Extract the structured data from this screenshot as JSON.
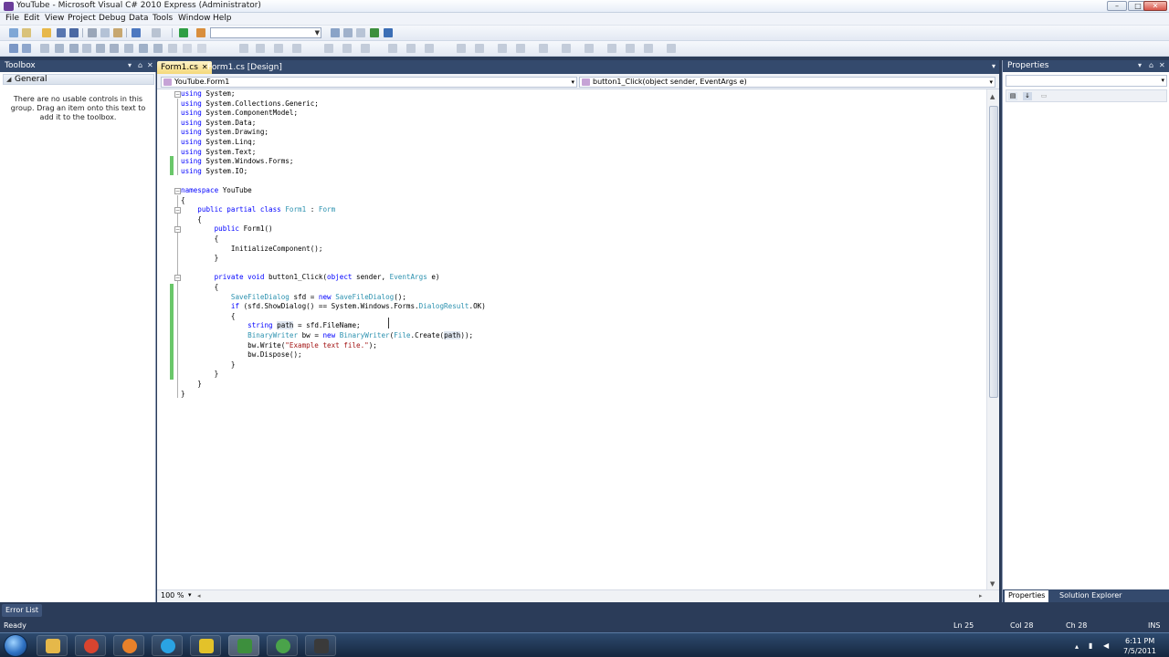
{
  "window": {
    "title": "YouTube - Microsoft Visual C# 2010 Express (Administrator)",
    "min_glyph": "–",
    "max_glyph": "□",
    "close_glyph": "✕"
  },
  "menu": [
    {
      "label": "File"
    },
    {
      "label": "Edit"
    },
    {
      "label": "View"
    },
    {
      "label": "Project"
    },
    {
      "label": "Debug"
    },
    {
      "label": "Data"
    },
    {
      "label": "Tools"
    },
    {
      "label": "Window"
    },
    {
      "label": "Help"
    }
  ],
  "toolbox": {
    "title": "Toolbox",
    "pin_glyph": "⌂",
    "close_glyph": "✕",
    "group_label": "General",
    "hint": "There are no usable controls in this group. Drag an item onto this text to add it to the toolbox."
  },
  "editor": {
    "tabs": [
      {
        "label": "Form1.cs",
        "active": true
      },
      {
        "label": "Form1.cs [Design]",
        "active": false
      }
    ],
    "tab_close_glyph": "✕",
    "nav_left": "YouTube.Form1",
    "nav_right": "button1_Click(object sender, EventArgs e)",
    "zoom": "100 %"
  },
  "code": {
    "l1": [
      {
        "k": "kw",
        "t": "using"
      },
      {
        "k": "",
        "t": " System;"
      }
    ],
    "l2": [
      {
        "k": "kw",
        "t": "using"
      },
      {
        "k": "",
        "t": " System.Collections.Generic;"
      }
    ],
    "l3": [
      {
        "k": "kw",
        "t": "using"
      },
      {
        "k": "",
        "t": " System.ComponentModel;"
      }
    ],
    "l4": [
      {
        "k": "kw",
        "t": "using"
      },
      {
        "k": "",
        "t": " System.Data;"
      }
    ],
    "l5": [
      {
        "k": "kw",
        "t": "using"
      },
      {
        "k": "",
        "t": " System.Drawing;"
      }
    ],
    "l6": [
      {
        "k": "kw",
        "t": "using"
      },
      {
        "k": "",
        "t": " System.Linq;"
      }
    ],
    "l7": [
      {
        "k": "kw",
        "t": "using"
      },
      {
        "k": "",
        "t": " System.Text;"
      }
    ],
    "l8": [
      {
        "k": "kw",
        "t": "using"
      },
      {
        "k": "",
        "t": " System.Windows.Forms;"
      }
    ],
    "l9": [
      {
        "k": "kw",
        "t": "using"
      },
      {
        "k": "",
        "t": " System.IO;"
      }
    ],
    "l10": [],
    "l11": [
      {
        "k": "kw",
        "t": "namespace"
      },
      {
        "k": "",
        "t": " YouTube"
      }
    ],
    "l12": [
      {
        "k": "",
        "t": "{"
      }
    ],
    "l13": [
      {
        "k": "",
        "t": "    "
      },
      {
        "k": "kw",
        "t": "public partial class"
      },
      {
        "k": "",
        "t": " "
      },
      {
        "k": "ty",
        "t": "Form1"
      },
      {
        "k": "",
        "t": " : "
      },
      {
        "k": "ty",
        "t": "Form"
      }
    ],
    "l14": [
      {
        "k": "",
        "t": "    {"
      }
    ],
    "l15": [
      {
        "k": "",
        "t": "        "
      },
      {
        "k": "kw",
        "t": "public"
      },
      {
        "k": "",
        "t": " Form1()"
      }
    ],
    "l16": [
      {
        "k": "",
        "t": "        {"
      }
    ],
    "l17": [
      {
        "k": "",
        "t": "            InitializeComponent();"
      }
    ],
    "l18": [
      {
        "k": "",
        "t": "        }"
      }
    ],
    "l19": [],
    "l20": [
      {
        "k": "",
        "t": "        "
      },
      {
        "k": "kw",
        "t": "private void"
      },
      {
        "k": "",
        "t": " button1_Click("
      },
      {
        "k": "kw",
        "t": "object"
      },
      {
        "k": "",
        "t": " sender, "
      },
      {
        "k": "ty",
        "t": "EventArgs"
      },
      {
        "k": "",
        "t": " e)"
      }
    ],
    "l21": [
      {
        "k": "",
        "t": "        {"
      }
    ],
    "l22": [
      {
        "k": "",
        "t": "            "
      },
      {
        "k": "ty",
        "t": "SaveFileDialog"
      },
      {
        "k": "",
        "t": " sfd = "
      },
      {
        "k": "kw",
        "t": "new"
      },
      {
        "k": "",
        "t": " "
      },
      {
        "k": "ty",
        "t": "SaveFileDialog"
      },
      {
        "k": "",
        "t": "();"
      }
    ],
    "l23": [
      {
        "k": "",
        "t": "            "
      },
      {
        "k": "kw",
        "t": "if"
      },
      {
        "k": "",
        "t": " (sfd.ShowDialog() == System.Windows.Forms."
      },
      {
        "k": "ty",
        "t": "DialogResult"
      },
      {
        "k": "",
        "t": ".OK)"
      }
    ],
    "l24": [
      {
        "k": "",
        "t": "            {"
      }
    ],
    "l25": [
      {
        "k": "",
        "t": "                "
      },
      {
        "k": "kw",
        "t": "string"
      },
      {
        "k": "",
        "t": " "
      },
      {
        "k": "hl",
        "t": "path"
      },
      {
        "k": "",
        "t": " = sfd.FileName;"
      }
    ],
    "l26": [
      {
        "k": "",
        "t": "                "
      },
      {
        "k": "ty",
        "t": "BinaryWriter"
      },
      {
        "k": "",
        "t": " bw = "
      },
      {
        "k": "kw",
        "t": "new"
      },
      {
        "k": "",
        "t": " "
      },
      {
        "k": "ty",
        "t": "BinaryWriter"
      },
      {
        "k": "",
        "t": "("
      },
      {
        "k": "ty",
        "t": "File"
      },
      {
        "k": "",
        "t": ".Create("
      },
      {
        "k": "hl",
        "t": "path"
      },
      {
        "k": "",
        "t": "));"
      }
    ],
    "l27": [
      {
        "k": "",
        "t": "                bw.Write("
      },
      {
        "k": "st",
        "t": "\"Example text file.\""
      },
      {
        "k": "",
        "t": ");"
      }
    ],
    "l28": [
      {
        "k": "",
        "t": "                bw.Dispose();"
      }
    ],
    "l29": [
      {
        "k": "",
        "t": "            }"
      }
    ],
    "l30": [
      {
        "k": "",
        "t": "        }"
      }
    ],
    "l31": [
      {
        "k": "",
        "t": "    }"
      }
    ],
    "l32": [
      {
        "k": "",
        "t": "}"
      }
    ]
  },
  "properties": {
    "title": "Properties",
    "pin_glyph": "⌂",
    "close_glyph": "✕",
    "tabs": [
      {
        "label": "Properties",
        "active": true
      },
      {
        "label": "Solution Explorer",
        "active": false
      }
    ]
  },
  "error_list": {
    "label": "Error List"
  },
  "status": {
    "ready": "Ready",
    "ln": "Ln 25",
    "col": "Col 28",
    "ch": "Ch 28",
    "ins": "INS"
  },
  "taskbar": {
    "time": "6:11 PM",
    "date": "7/5/2011"
  },
  "colors": {
    "keyword": "#0000ff",
    "type": "#2b91af",
    "string": "#a31515",
    "changed": "#6ac76a",
    "chrome": "#344a6d"
  }
}
